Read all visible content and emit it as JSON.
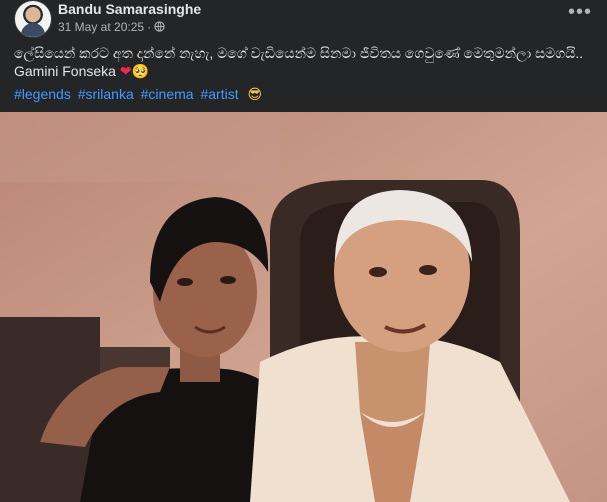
{
  "post": {
    "author": "Bandu Samarasinghe",
    "date": "31 May at 20:25",
    "separator": "·",
    "more_label": "•••",
    "caption": "ලේසියෙන් කරට අත දාන්නේ නැහැ, මගේ වැඩියෙන්ම සිනමා ජීවිතය ගෙවුණේ මෙතුමන්ලා සමගයි.. Gamini Fonseka",
    "caption_emoji_heart": "❤",
    "caption_emoji_face": "🥺",
    "hashtags": [
      "#legends",
      "#srilanka",
      "#cinema",
      "#artist"
    ],
    "tags_emoji": "😎",
    "photo_subject": "photo"
  }
}
